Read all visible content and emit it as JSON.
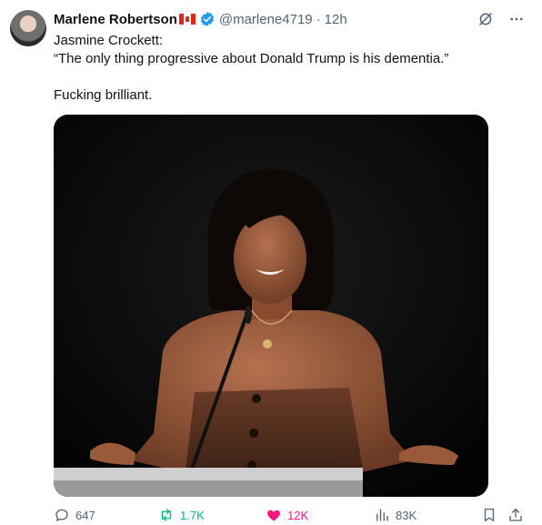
{
  "author": {
    "name": "Marlene Robertson",
    "handle": "@marlene4719",
    "separator": "·",
    "time": "12h"
  },
  "post": {
    "line1": "Jasmine Crockett:",
    "line2": "“The only thing progressive about Donald Trump is his dementia.”",
    "line3": "Fucking brilliant."
  },
  "actions": {
    "replies": "647",
    "reposts": "1.7K",
    "likes": "12K",
    "views": "83K"
  },
  "colors": {
    "accent_blue": "#1d9bf0",
    "repost_green": "#00ba7c",
    "like_pink": "#f91880",
    "muted": "#536471"
  },
  "icons": {
    "verified": "verified-badge-icon",
    "grok": "grok-icon",
    "more": "more-icon",
    "reply": "reply-icon",
    "repost": "repost-icon",
    "like": "heart-filled-icon",
    "views": "views-icon",
    "bookmark": "bookmark-icon",
    "share": "share-icon"
  }
}
